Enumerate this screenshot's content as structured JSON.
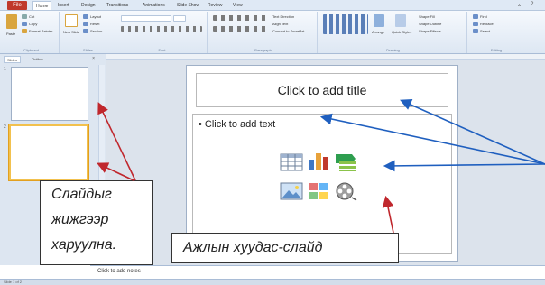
{
  "ribbon": {
    "file_tab": "File",
    "tabs": [
      "Home",
      "Insert",
      "Design",
      "Transitions",
      "Animations",
      "Slide Show",
      "Review",
      "View"
    ],
    "clipboard": {
      "paste": "Paste",
      "cut": "Cut",
      "copy": "Copy",
      "format_painter": "Format Painter",
      "label": "Clipboard"
    },
    "slides": {
      "new_slide": "New Slide",
      "layout": "Layout",
      "reset": "Reset",
      "section": "Section",
      "label": "Slides"
    },
    "font": {
      "label": "Font"
    },
    "paragraph": {
      "text_direction": "Text Direction",
      "align_text": "Align Text",
      "convert_smartart": "Convert to SmartArt",
      "label": "Paragraph"
    },
    "drawing": {
      "arrange": "Arrange",
      "quick_styles": "Quick Styles",
      "shape_fill": "Shape Fill",
      "shape_outline": "Shape Outline",
      "shape_effects": "Shape Effects",
      "label": "Drawing"
    },
    "editing": {
      "find": "Find",
      "replace": "Replace",
      "select": "Select",
      "label": "Editing"
    }
  },
  "left_pane": {
    "tabs": [
      "Slides",
      "Outline"
    ],
    "slide_numbers": [
      "1",
      "2"
    ]
  },
  "slide": {
    "title_placeholder": "Click to add title",
    "content_placeholder": "Click to add text",
    "bullet": "•"
  },
  "notes_placeholder": "Click to add notes",
  "status": "Slide 1 of 2",
  "callouts": {
    "left_lines": [
      "Слайдыг",
      "жижгээр",
      "харуулна."
    ],
    "bottom": "Ажлын хуудас-слайд"
  },
  "colors": {
    "arrow_red": "#c0272d",
    "arrow_blue": "#1f5fbf",
    "selected_thumb": "#f2c14e",
    "file_tab": "#c0392b"
  },
  "icons": [
    "table-icon",
    "chart-icon",
    "smartart-icon",
    "picture-icon",
    "clipart-icon",
    "media-icon"
  ]
}
